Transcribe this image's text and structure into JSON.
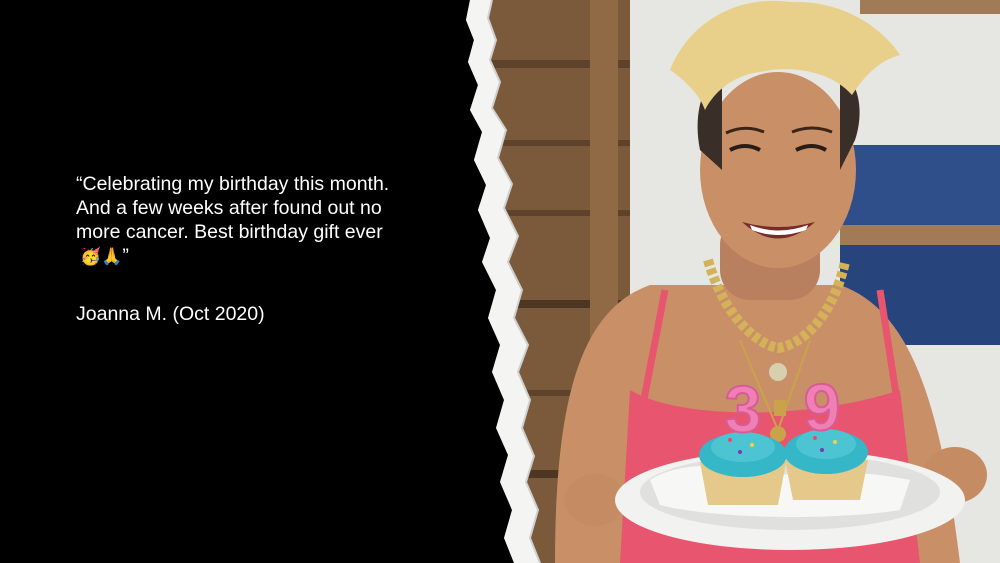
{
  "quote": {
    "text": "“Celebrating my birthday this month. And a few weeks after found out no more cancer. Best birthday gift ever",
    "emojis": "🥳🙏",
    "closing_mark": "”"
  },
  "attribution": "Joanna M. (Oct 2020)",
  "photo": {
    "candle_digits": [
      "3",
      "9"
    ],
    "colors": {
      "wall_wood": "#7a5a3a",
      "wall_white": "#e6e6e2",
      "wall_blue": "#2f4f8a",
      "top": "#e8556e",
      "frosting": "#35b7c8",
      "candles": "#f07fb4",
      "hair": "#e8d08a",
      "skin": "#c99068"
    }
  }
}
